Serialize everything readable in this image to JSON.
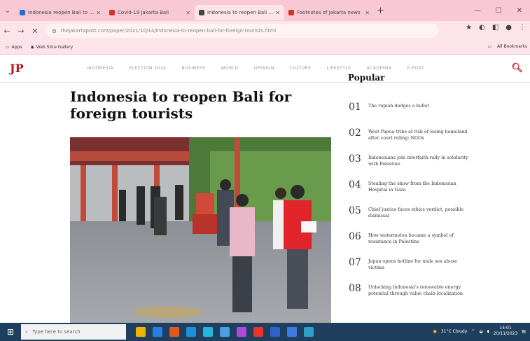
{
  "browser": {
    "tabs": [
      {
        "label": "Indonesia reopen Bali to tourists",
        "color": "#2b6bd6"
      },
      {
        "label": "Covid-19 Jakarta Bali",
        "color": "#d6322b"
      },
      {
        "label": "Indonesia to reopen Bali for foreign",
        "color": "#444444",
        "active": true
      },
      {
        "label": "Footnotes of Jakarta news",
        "color": "#d6322b"
      }
    ],
    "url": "thejakartapost.com/paper/2021/10/14/indonesia-to-reopen-bali-for-foreign-tourists.html",
    "bookmarks": [
      "Apps",
      "Web Slice Gallery"
    ],
    "bookmarks_right": "All Bookmarks"
  },
  "site": {
    "logo": "JP",
    "nav": [
      "INDONESIA",
      "ELECTION 2024",
      "BUSINESS",
      "WORLD",
      "OPINION",
      "CULTURE",
      "LIFESTYLE",
      "ACADEMIA",
      "E-POST"
    ]
  },
  "article": {
    "headline": "Indonesia to reopen Bali for foreign tourists"
  },
  "popular": {
    "title": "Popular",
    "items": [
      {
        "num": "01",
        "text": "The rupiah dodges a bullet"
      },
      {
        "num": "02",
        "text": "West Papua tribe at risk of losing homeland after court ruling: NGOs"
      },
      {
        "num": "03",
        "text": "Indonesians join interfaith rally in solidarity with Palestine"
      },
      {
        "num": "04",
        "text": "Stealing the show from the Indonesian Hospital in Gaza"
      },
      {
        "num": "05",
        "text": "Chief justice faces ethics verdict, possible dismissal"
      },
      {
        "num": "06",
        "text": "How watermelon became a symbol of resistance in Palestine"
      },
      {
        "num": "07",
        "text": "Japan opens hotline for male sex abuse victims"
      },
      {
        "num": "08",
        "text": "Unlocking Indonesia's renewable energy potential through value chain localization"
      }
    ]
  },
  "taskbar": {
    "search_placeholder": "Type here to search",
    "weather": "31°C Cloudy",
    "time": "14:01",
    "date": "20/11/2023",
    "app_colors": [
      "#f0b400",
      "#2d7de0",
      "#e05a1e",
      "#1e90d8",
      "#26b5e0",
      "#4aa0e0",
      "#b04ad8",
      "#e8342b",
      "#2d62c8",
      "#3c7be0",
      "#2da0c8"
    ]
  }
}
